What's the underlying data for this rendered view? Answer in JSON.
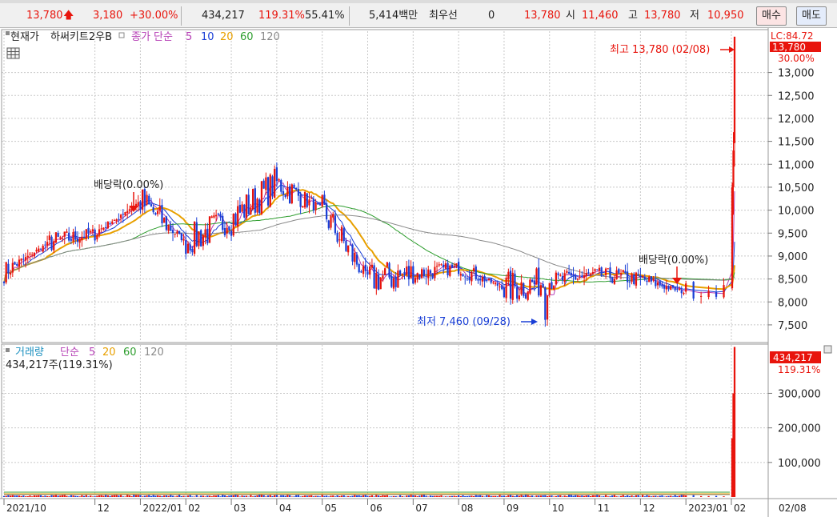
{
  "quote": {
    "price": "13,780",
    "arrow": "🡅",
    "change": "3,180",
    "change_pct": "+30.00%",
    "volume": "434,217",
    "volume_ratio": "119.31%",
    "turnover_ratio": "55.41%",
    "amount": "5,414백만",
    "bid_label": "최우선",
    "bid_value": "0",
    "ask_price": "13,780",
    "open_label": "시",
    "open": "11,460",
    "high_label": "고",
    "high": "13,780",
    "low_label": "저",
    "low": "10,950",
    "buy_button": "매수",
    "sell_button": "매도"
  },
  "price_panel": {
    "title": "현재가",
    "stock_name": "하써키트2우B",
    "ma_label": "종가 단순",
    "ma_periods": [
      "5",
      "10",
      "20",
      "60",
      "120"
    ],
    "top_right_label": "LC:84.72",
    "current_tag": "13,780",
    "current_pct": "30.00%",
    "high_annotation": "최고 13,780 (02/08)",
    "low_annotation": "최저 7,460 (09/28)",
    "dividend_label_1": "배당락(0.00%)",
    "dividend_label_2": "배당락(0.00%)",
    "y_ticks": [
      "13,000",
      "12,500",
      "12,000",
      "11,500",
      "11,000",
      "10,500",
      "10,000",
      "9,500",
      "9,000",
      "8,500",
      "8,000",
      "7,500"
    ]
  },
  "volume_panel": {
    "title": "거래량",
    "ma_label": "단순",
    "ma_periods": [
      "5",
      "20",
      "60",
      "120"
    ],
    "info": "434,217주(119.31%)",
    "current_tag": "434,217",
    "current_pct": "119.31%",
    "y_ticks": [
      "300,000",
      "200,000",
      "100,000"
    ]
  },
  "x_axis": {
    "labels": [
      "2021/10",
      "12",
      "2022/01",
      "02",
      "03",
      "04",
      "05",
      "06",
      "07",
      "08",
      "09",
      "10",
      "11",
      "12",
      "2023/01",
      "02"
    ],
    "right_label": "02/08"
  },
  "colors": {
    "up": "#e8140c",
    "down": "#1a3fd6",
    "ma5": "#b53fb5",
    "ma10": "#1a3fd6",
    "ma20": "#e8a000",
    "ma60": "#2f9e2f",
    "ma120": "#8a8a8a",
    "grid": "#c8c8c8"
  },
  "chart_data": [
    {
      "type": "candlestick",
      "title": "하써키트2우B",
      "x": [
        "2021/10",
        "2021/11",
        "2021/12",
        "2022/01",
        "2022/02",
        "2022/03",
        "2022/04",
        "2022/05",
        "2022/06",
        "2022/07",
        "2022/08",
        "2022/09",
        "2022/10",
        "2022/11",
        "2022/12",
        "2023/01",
        "2023/02"
      ],
      "close_approx": [
        8650,
        9300,
        9500,
        10200,
        9300,
        9800,
        10600,
        10000,
        8500,
        8600,
        8750,
        8300,
        8450,
        8600,
        8500,
        8200,
        13780
      ],
      "high_approx": [
        9050,
        9700,
        9800,
        11200,
        10200,
        11850,
        11050,
        10800,
        9500,
        8950,
        9000,
        8950,
        8800,
        8850,
        8800,
        8600,
        13780
      ],
      "low_approx": [
        8250,
        8700,
        9100,
        9300,
        8800,
        9200,
        9900,
        8400,
        7550,
        8100,
        8350,
        7460,
        8100,
        8250,
        8200,
        7950,
        8100
      ],
      "last_candle": {
        "date": "02/08",
        "open": 11460,
        "high": 13780,
        "low": 10950,
        "close": 13780
      },
      "highest": {
        "value": 13780,
        "date": "02/08"
      },
      "lowest": {
        "value": 7460,
        "date": "09/28"
      },
      "ylim": [
        7150,
        13900
      ],
      "grid": true
    },
    {
      "type": "bar",
      "title": "거래량",
      "last_value": 434217,
      "last_ratio_pct": 119.31,
      "ylim": [
        0,
        440000
      ],
      "grid": true
    }
  ]
}
